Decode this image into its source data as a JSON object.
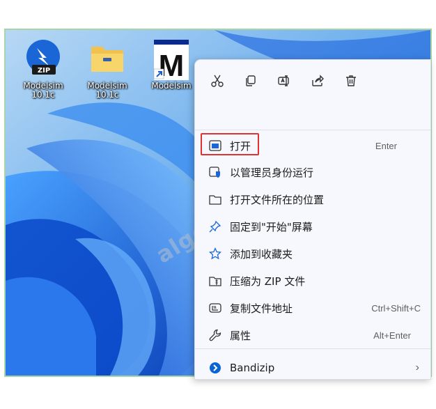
{
  "desktop": {
    "icons": [
      {
        "name": "Modelsim 10.1c",
        "line1": "Modelsim",
        "line2": "10.1c",
        "kind": "zip"
      },
      {
        "name": "Modelsim 10.1c",
        "line1": "Modelsim",
        "line2": "10.1c",
        "kind": "folder"
      },
      {
        "name": "Modelsim",
        "line1": "Modelsim",
        "line2": "",
        "kind": "shortcut"
      }
    ],
    "zip_badge": "ZIP",
    "shortcut_letter": "M",
    "watermark": "algorithmage"
  },
  "context_menu": {
    "quick_actions": [
      {
        "name": "cut",
        "icon": "scissors-icon"
      },
      {
        "name": "copy",
        "icon": "copy-icon"
      },
      {
        "name": "rename",
        "icon": "rename-icon"
      },
      {
        "name": "share",
        "icon": "share-icon"
      },
      {
        "name": "delete",
        "icon": "trash-icon"
      }
    ],
    "items": [
      {
        "label": "打开",
        "shortcut": "Enter",
        "icon": "open-window-icon",
        "highlighted": true
      },
      {
        "label": "以管理员身份运行",
        "shortcut": "",
        "icon": "admin-shield-icon"
      },
      {
        "label": "打开文件所在的位置",
        "shortcut": "",
        "icon": "folder-icon"
      },
      {
        "label": "固定到\"开始\"屏幕",
        "shortcut": "",
        "icon": "pin-icon"
      },
      {
        "label": "添加到收藏夹",
        "shortcut": "",
        "icon": "star-icon"
      },
      {
        "label": "压缩为 ZIP 文件",
        "shortcut": "",
        "icon": "zip-archive-icon"
      },
      {
        "label": "复制文件地址",
        "shortcut": "Ctrl+Shift+C",
        "icon": "copy-path-icon"
      },
      {
        "label": "属性",
        "shortcut": "Alt+Enter",
        "icon": "wrench-icon"
      },
      {
        "label": "Bandizip",
        "shortcut": "›",
        "icon": "bandizip-icon"
      }
    ]
  },
  "colors": {
    "wallpaper_base": "#1a6fe0",
    "menu_bg": "#f6f8fd",
    "highlight_border": "#e0322e",
    "accent_blue": "#0a64d8"
  }
}
